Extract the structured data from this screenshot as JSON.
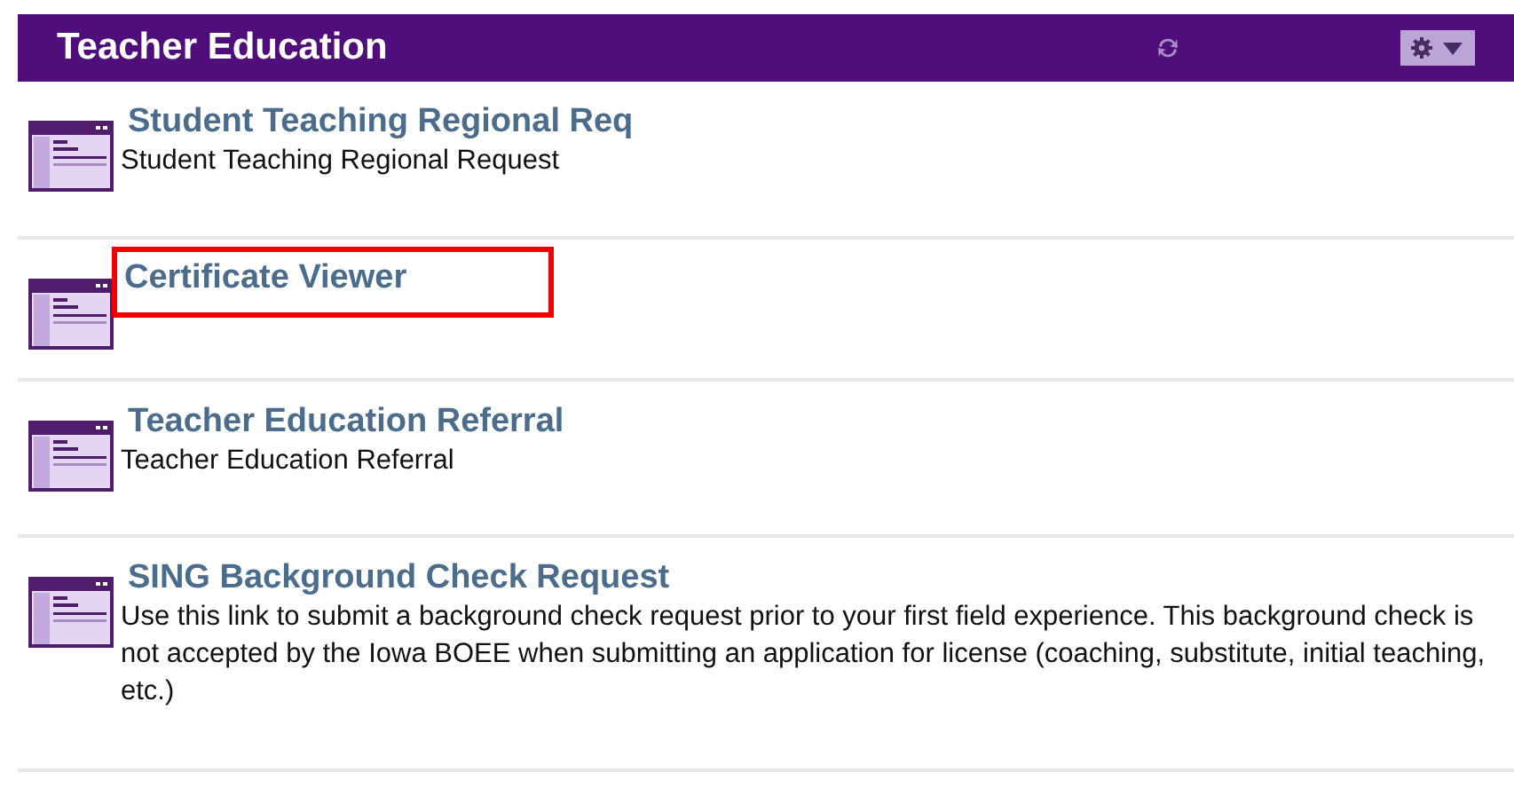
{
  "header": {
    "title": "Teacher Education"
  },
  "items": [
    {
      "title": "Student Teaching Regional Req",
      "description": "Student Teaching Regional Request",
      "highlighted": false
    },
    {
      "title": "Certificate Viewer",
      "highlighted": true
    },
    {
      "title": "Teacher Education Referral",
      "description": "Teacher Education Referral",
      "highlighted": false
    },
    {
      "title": "SING Background Check Request",
      "description": "Use this link to submit a background check request prior to your first field experience. This background check is not accepted by the Iowa BOEE when submitting an application for license (coaching, substitute, initial teaching, etc.)",
      "highlighted": false
    }
  ]
}
